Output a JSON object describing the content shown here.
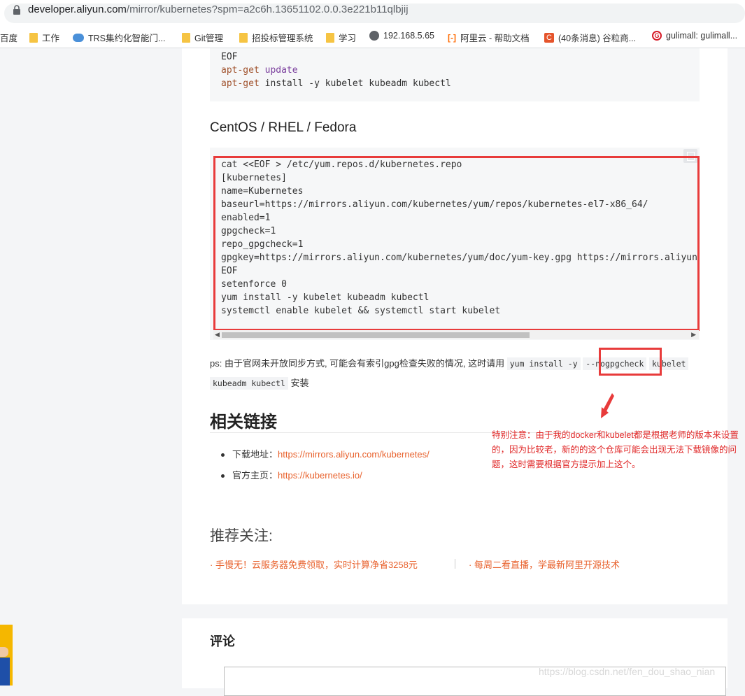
{
  "browser": {
    "url_host": "developer.aliyun.com",
    "url_path": "/mirror/kubernetes?spm=a2c6h.13651102.0.0.3e221b11qlbjij",
    "bookmarks": [
      {
        "label": "百度",
        "icon": "none"
      },
      {
        "label": "工作",
        "icon": "folder-icon"
      },
      {
        "label": "TRS集约化智能门...",
        "icon": "cloud-icon"
      },
      {
        "label": "Git管理",
        "icon": "folder-icon"
      },
      {
        "label": "招投标管理系统",
        "icon": "folder-icon"
      },
      {
        "label": "学习",
        "icon": "folder-icon"
      },
      {
        "label": "192.168.5.65",
        "icon": "globe-icon"
      },
      {
        "label": "阿里云 - 帮助文档",
        "icon": "aliyun-icon"
      },
      {
        "label": "(40条消息) 谷粒商...",
        "icon": "csdn-icon"
      },
      {
        "label": "gulimall: gulimall...",
        "icon": "gitee-icon"
      }
    ]
  },
  "debian_code": {
    "lines": [
      "EOF",
      "apt-get update",
      "apt-get install -y kubelet kubeadm kubectl"
    ]
  },
  "centos": {
    "heading": "CentOS / RHEL / Fedora",
    "code_lines": [
      "cat <<EOF > /etc/yum.repos.d/kubernetes.repo",
      "[kubernetes]",
      "name=Kubernetes",
      "baseurl=https://mirrors.aliyun.com/kubernetes/yum/repos/kubernetes-el7-x86_64/",
      "enabled=1",
      "gpgcheck=1",
      "repo_gpgcheck=1",
      "gpgkey=https://mirrors.aliyun.com/kubernetes/yum/doc/yum-key.gpg https://mirrors.aliyun.com",
      "EOF",
      "setenforce 0",
      "yum install -y kubelet kubeadm kubectl",
      "systemctl enable kubelet && systemctl start kubelet"
    ]
  },
  "ps": {
    "text": "ps: 由于官网未开放同步方式, 可能会有索引gpg检查失败的情况, 这时请用",
    "code1": "yum install -y",
    "code2": "--nogpgcheck",
    "code3": "kubelet",
    "code4": "kubeadm kubectl",
    "suffix": "安装"
  },
  "links": {
    "heading": "相关链接",
    "items": [
      {
        "label": "下载地址：",
        "url": "https://mirrors.aliyun.com/kubernetes/"
      },
      {
        "label": "官方主页：",
        "url": "https://kubernetes.io/"
      }
    ]
  },
  "recommend": {
    "title": "推荐关注:",
    "items": [
      "· 手慢无！云服务器免费领取，实时计算净省3258元",
      "· 每周二看直播，学最新阿里开源技术"
    ]
  },
  "annotation": {
    "text": "特别注意：由于我的docker和kubelet都是根据老师的版本来设置的，因为比较老，新的的这个仓库可能会出现无法下载镜像的问题，这时需要根据官方提示加上这个。"
  },
  "comments": {
    "title": "评论"
  },
  "watermark": "https://blog.csdn.net/fen_dou_shao_nian",
  "colors": {
    "annotation_red": "#e83b3b",
    "link_orange": "#e8612c"
  }
}
